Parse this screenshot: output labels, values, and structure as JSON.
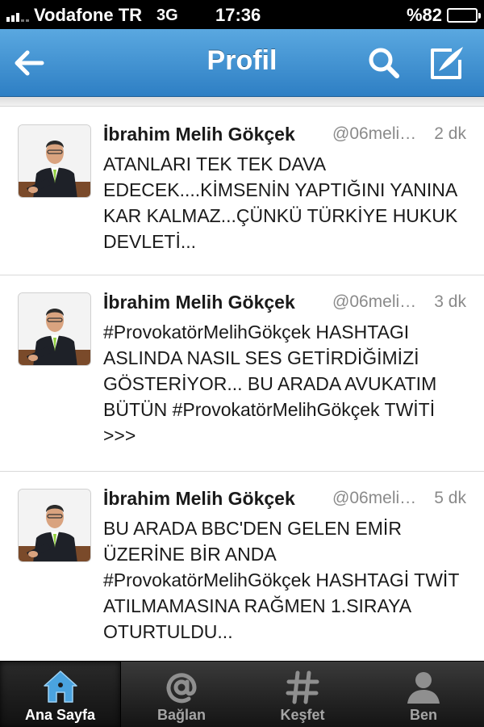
{
  "status_bar": {
    "carrier": "Vodafone TR",
    "network": "3G",
    "time": "17:36",
    "battery": "%82",
    "battery_level": 0.82
  },
  "nav": {
    "title": "Profil",
    "icons": [
      "back-arrow-icon",
      "search-icon",
      "compose-icon"
    ]
  },
  "tweets": [
    {
      "name": "İbrahim Melih Gökçek",
      "handle": "@06meli…",
      "time": "2 dk",
      "text": "ATANLARI TEK TEK DAVA EDECEK....KİMSENİN YAPTIĞINI YANINA KAR KALMAZ...ÇÜNKÜ TÜRKİYE HUKUK DEVLETİ..."
    },
    {
      "name": "İbrahim Melih Gökçek",
      "handle": "@06meli…",
      "time": "3 dk",
      "text": "#ProvokatörMelihGökçek HASHTAGI ASLINDA NASIL SES GETİRDİĞİMİZİ GÖSTERİYOR... BU ARADA AVUKATIM BÜTÜN #ProvokatörMelihGökçek TWİTİ >>>"
    },
    {
      "name": "İbrahim Melih Gökçek",
      "handle": "@06meli…",
      "time": "5 dk",
      "text": "BU ARADA BBC'DEN GELEN EMİR ÜZERİNE BİR ANDA #ProvokatörMelihGökçek HASHTAGİ TWİT ATILMAMASINA RAĞMEN 1.SIRAYA OTURTULDU..."
    }
  ],
  "tabs": [
    {
      "label": "Ana Sayfa",
      "icon": "home-icon",
      "active": true
    },
    {
      "label": "Bağlan",
      "icon": "at-icon",
      "active": false
    },
    {
      "label": "Keşfet",
      "icon": "hashtag-icon",
      "active": false
    },
    {
      "label": "Ben",
      "icon": "person-icon",
      "active": false
    }
  ],
  "colors": {
    "nav_top": "#5aa8e0",
    "nav_bottom": "#2e7fc4",
    "active_tab_icon": "#4aa3df"
  }
}
